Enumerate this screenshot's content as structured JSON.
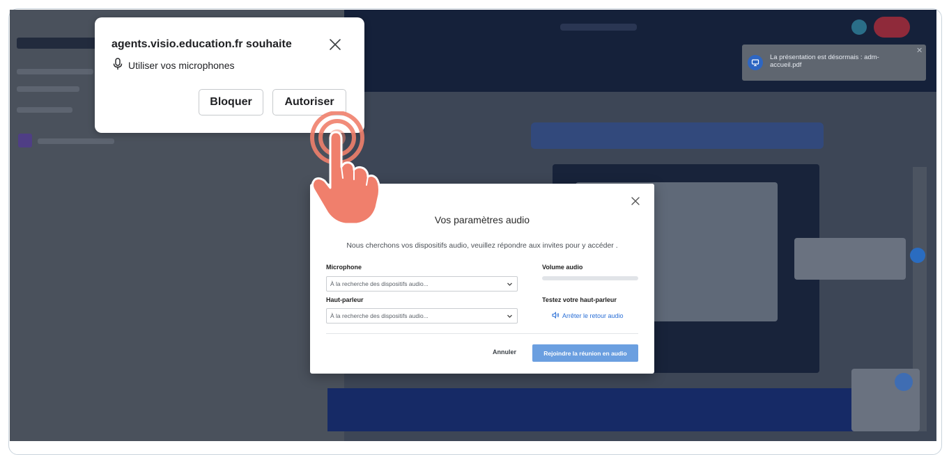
{
  "permission_prompt": {
    "title": "agents.visio.education.fr souhaite",
    "permission_text": "Utiliser vos microphones",
    "block_label": "Bloquer",
    "allow_label": "Autoriser"
  },
  "notification": {
    "text": "La présentation est désormais : adm-accueil.pdf"
  },
  "audio_modal": {
    "title": "Vos paramètres audio",
    "description": "Nous cherchons vos dispositifs audio, veuillez répondre aux invites pour y accéder .",
    "microphone_label": "Microphone",
    "microphone_value": "À la recherche des dispositifs audio...",
    "speaker_label": "Haut-parleur",
    "speaker_value": "À la recherche des dispositifs audio...",
    "volume_label": "Volume audio",
    "test_label": "Testez votre haut-parleur",
    "stop_echo_label": "Arrêter le retour audio",
    "cancel_label": "Annuler",
    "join_label": "Rejoindre la réunion en audio"
  },
  "colors": {
    "accent_blue": "#6b9fe0",
    "hand_coral": "#f07f6c",
    "app_header": "#15213a"
  }
}
